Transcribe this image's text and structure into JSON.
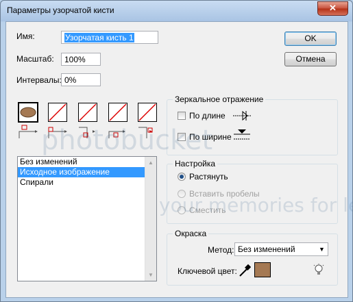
{
  "window": {
    "title": "Параметры узорчатой кисти",
    "close_symbol": "✕"
  },
  "form": {
    "name_label": "Имя:",
    "name_value": "Узорчатая кисть 1",
    "scale_label": "Масштаб:",
    "scale_value": "100%",
    "spacing_label": "Интервалы:",
    "spacing_value": "0%"
  },
  "buttons": {
    "ok": "OK",
    "cancel": "Отмена"
  },
  "tiles": [
    {
      "name": "side-tile",
      "swatch": "#a57953"
    },
    {
      "name": "outer-corner-tile"
    },
    {
      "name": "inner-corner-tile"
    },
    {
      "name": "start-tile"
    },
    {
      "name": "end-tile"
    }
  ],
  "tile_list": {
    "items": [
      "Без изменений",
      "Исходное изображение",
      "Спирали"
    ],
    "selected": "Исходное изображение"
  },
  "mirror": {
    "title": "Зеркальное отражение",
    "length_label": "По длине",
    "width_label": "По ширине"
  },
  "fit": {
    "title": "Настройка",
    "stretch": "Растянуть",
    "add_space": "Вставить пробелы",
    "shift": "Сместить",
    "selected": "Растянуть"
  },
  "color": {
    "title": "Окраска",
    "method_label": "Метод:",
    "method_value": "Без изменений",
    "key_color_label": "Ключевой цвет:",
    "key_color": "#a57953"
  },
  "watermark": {
    "logo_text": "photobucket",
    "slogan": "your memories for less!"
  },
  "colors": {
    "accent": "#3399ff",
    "title_bar": "#b9d1ea"
  }
}
